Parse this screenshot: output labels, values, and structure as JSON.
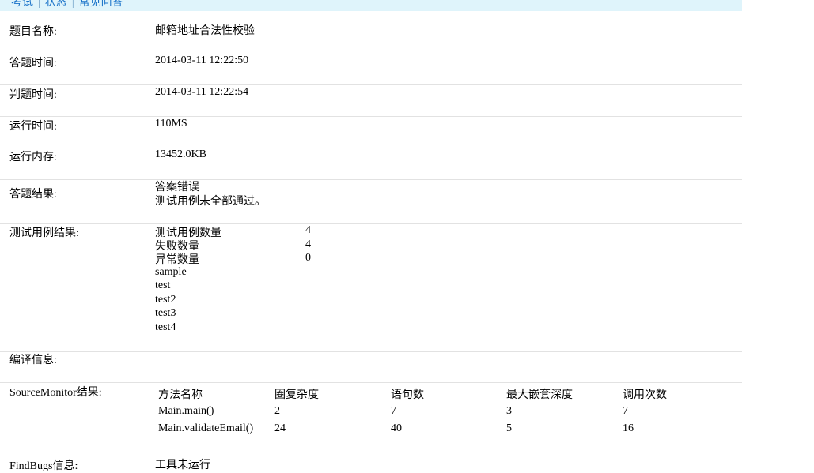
{
  "nav": {
    "items": [
      "考试",
      "状态",
      "常见问答"
    ]
  },
  "fields": {
    "title": {
      "label": "题目名称:",
      "value": "邮箱地址合法性校验"
    },
    "answer_time": {
      "label": "答题时间:",
      "value": "2014-03-11 12:22:50"
    },
    "judge_time": {
      "label": "判题时间:",
      "value": "2014-03-11 12:22:54"
    },
    "run_time": {
      "label": "运行时间:",
      "value": "110MS"
    },
    "run_memory": {
      "label": "运行内存:",
      "value": "13452.0KB"
    },
    "result": {
      "label": "答题结果:",
      "line1": "答案错误",
      "line2": "测试用例未全部通过。"
    },
    "testcases": {
      "label": "测试用例结果:",
      "stats": [
        {
          "name": "测试用例数量",
          "value": "4"
        },
        {
          "name": "失败数量",
          "value": "4"
        },
        {
          "name": "异常数量",
          "value": "0"
        }
      ],
      "cases": [
        "sample",
        "test",
        "test2",
        "test3",
        "test4"
      ]
    },
    "compile": {
      "label": "编译信息:"
    },
    "sourcemonitor": {
      "label": "SourceMonitor结果:",
      "headers": [
        "方法名称",
        "圈复杂度",
        "语句数",
        "最大嵌套深度",
        "调用次数"
      ],
      "rows": [
        [
          "Main.main()",
          "2",
          "7",
          "3",
          "7"
        ],
        [
          "Main.validateEmail()",
          "24",
          "40",
          "5",
          "16"
        ]
      ]
    },
    "findbugs": {
      "label": "FindBugs信息:",
      "value": "工具未运行"
    }
  }
}
